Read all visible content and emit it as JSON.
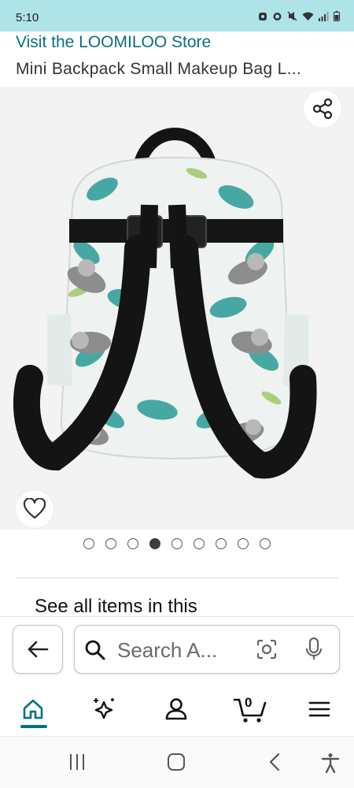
{
  "status_bar": {
    "time": "5:10"
  },
  "header": {
    "store_link": "Visit the LOOMILOO Store",
    "product_title": "Mini Backpack Small Makeup Bag L..."
  },
  "gallery": {
    "image_count": 9,
    "active_index": 3,
    "share_icon": "share-icon",
    "wishlist_icon": "heart-icon"
  },
  "section": {
    "see_all_text": "See all items in this"
  },
  "search": {
    "placeholder": "Search A..."
  },
  "bottom_nav": {
    "cart_count": "0",
    "items": [
      "home-icon",
      "ai-sparkle-icon",
      "account-icon",
      "cart-icon",
      "menu-icon"
    ]
  },
  "colors": {
    "status_bar_bg": "#aee3e8",
    "store_link": "#0a6d82",
    "accent": "#007185"
  }
}
